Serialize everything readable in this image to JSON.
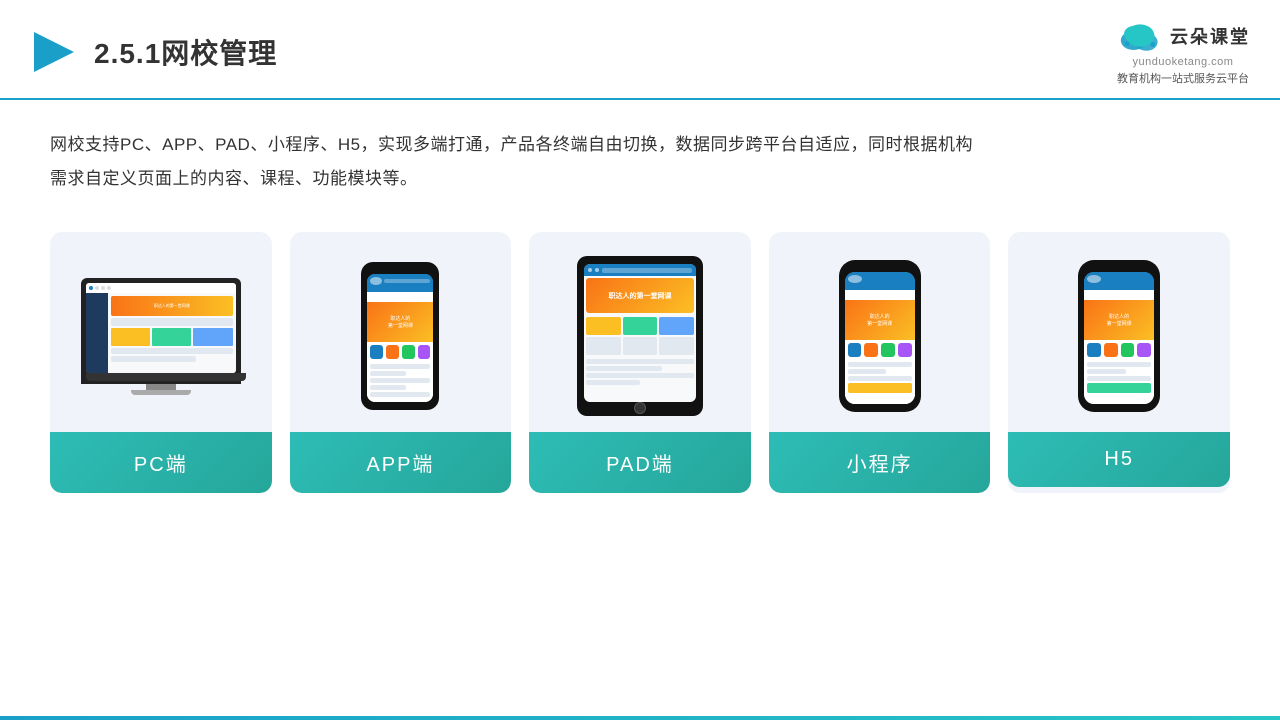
{
  "header": {
    "title": "2.5.1网校管理",
    "title_number": "2.5.1",
    "title_main": "网校管理"
  },
  "logo": {
    "text_cn": "云朵课堂",
    "url": "yunduoketang.com",
    "slogan": "教育机构一站式服务云平台"
  },
  "description": {
    "text": "网校支持PC、APP、PAD、小程序、H5，实现多端打通，产品各终端自由切换，数据同步跨平台自适应，同时根据机构需求自定义页面上的内容、课程、功能模块等。"
  },
  "cards": [
    {
      "id": "pc",
      "label": "PC端"
    },
    {
      "id": "app",
      "label": "APP端"
    },
    {
      "id": "pad",
      "label": "PAD端"
    },
    {
      "id": "miniprogram",
      "label": "小程序"
    },
    {
      "id": "h5",
      "label": "H5"
    }
  ]
}
